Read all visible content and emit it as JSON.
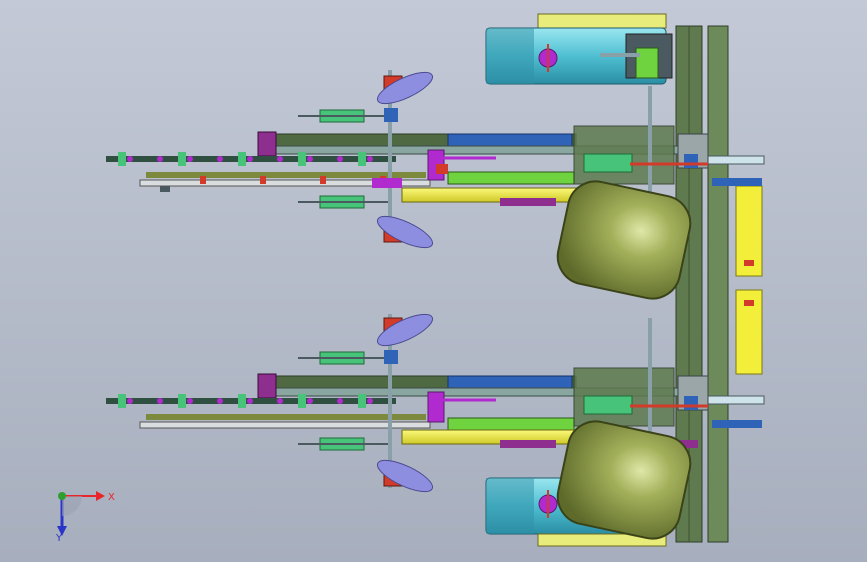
{
  "view": {
    "background_top": "#c3c9d6",
    "background_bottom": "#a7aebd"
  },
  "triad": {
    "x_label": "X",
    "y_label": "Y",
    "x_color": "#e8262a",
    "y_color": "#2a34c8",
    "origin_color": "#2e9e2e"
  },
  "colors": {
    "frame": "#5e7a4e",
    "frame_dark": "#3f5a34",
    "wheel_body": "#5ec8d8",
    "wheel_dark": "#2f8fa6",
    "hopper": "#7d8a3e",
    "hopper_light": "#b6c36a",
    "arm_yellow": "#f2ee3a",
    "arm_green": "#6fd23f",
    "arm_blue": "#2f63b8",
    "spring_green": "#48c47a",
    "magenta": "#b02ad0",
    "red": "#d23a2a",
    "purple_part": "#8e2e8e",
    "shaft": "#8aa0a8"
  }
}
